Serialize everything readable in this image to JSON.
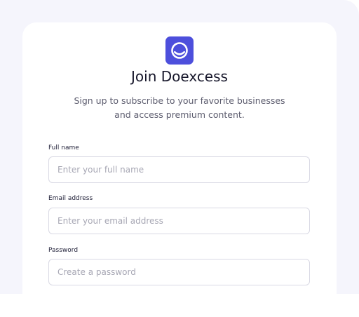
{
  "brand": {
    "logo_icon": "smiley-face-icon",
    "accent_color": "#4d4fdc"
  },
  "header": {
    "title": "Join Doexcess",
    "subtitle": "Sign up to subscribe to your favorite businesses and access premium content."
  },
  "form": {
    "full_name": {
      "label": "Full name",
      "placeholder": "Enter your full name",
      "value": ""
    },
    "email": {
      "label": "Email address",
      "placeholder": "Enter your email address",
      "value": ""
    },
    "password": {
      "label": "Password",
      "placeholder": "Create a password",
      "value": ""
    }
  }
}
